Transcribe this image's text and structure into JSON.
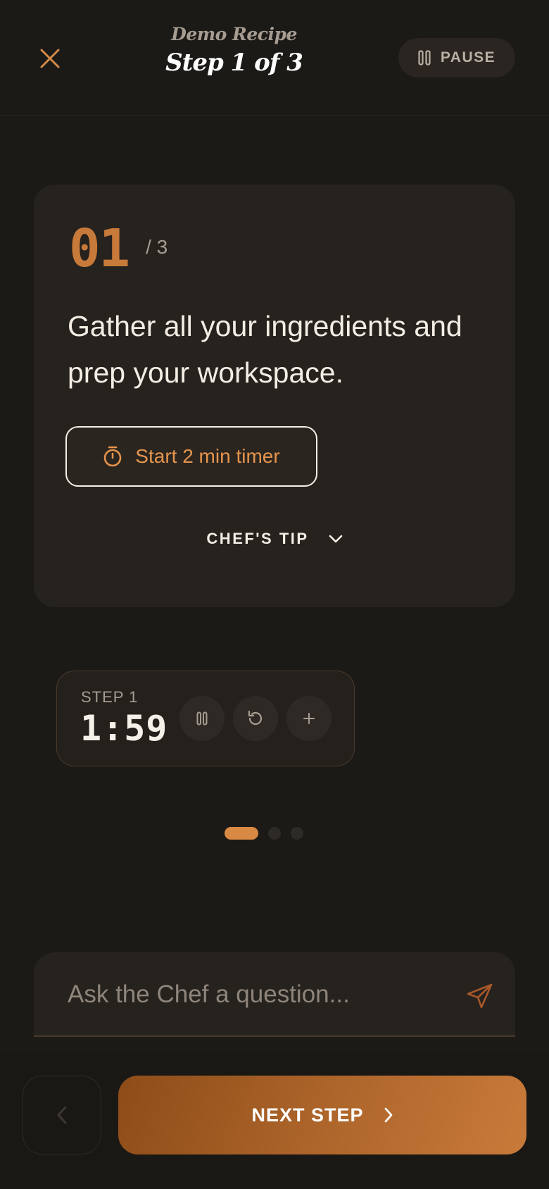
{
  "header": {
    "recipe_name": "Demo Recipe",
    "step_title": "Step 1 of 3",
    "pause_label": "PAUSE"
  },
  "step": {
    "number": "01",
    "total": "/ 3",
    "instruction": "Gather all your ingredients and prep your workspace.",
    "timer_button_label": "Start 2 min timer",
    "tip_label": "CHEF'S TIP"
  },
  "timer": {
    "label": "STEP 1",
    "time": "1:59"
  },
  "pagination": {
    "current": 1,
    "total": 3
  },
  "ask": {
    "placeholder": "Ask the Chef a question..."
  },
  "footer": {
    "next_label": "NEXT STEP"
  },
  "colors": {
    "accent": "#c87a3a",
    "background": "#1c1a17",
    "card": "#26221e"
  },
  "icons": {
    "close": "close-icon",
    "pause": "pause-icon",
    "stopwatch": "stopwatch-icon",
    "chevron": "chevron-down-icon",
    "reset": "reset-icon",
    "add": "plus-icon",
    "send": "send-icon",
    "prev": "chevron-left-icon",
    "next": "chevron-right-icon"
  }
}
